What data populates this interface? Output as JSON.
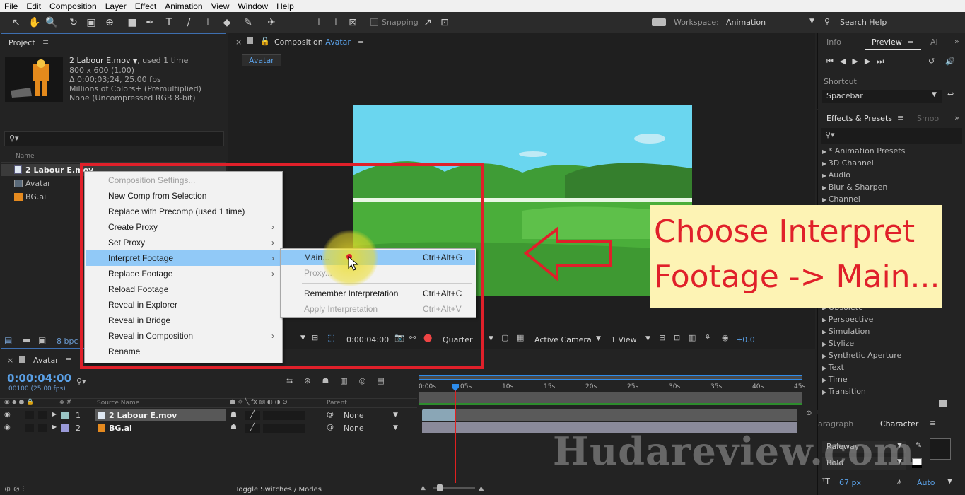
{
  "menubar": [
    "File",
    "Edit",
    "Composition",
    "Layer",
    "Effect",
    "Animation",
    "View",
    "Window",
    "Help"
  ],
  "toolbar": {
    "snapping": "Snapping",
    "workspace_label": "Workspace:",
    "workspace_value": "Animation",
    "search_help": "Search Help"
  },
  "project": {
    "title": "Project",
    "file_name": "2 Labour E.mov",
    "used": ", used 1 time",
    "dimensions": "800 x 600 (1.00)",
    "duration": "Δ 0;00;03;24, 25.00 fps",
    "colors": "Millions of Colors+ (Premultiplied)",
    "codec": "None (Uncompressed RGB 8-bit)",
    "name_col": "Name",
    "items": [
      "2 Labour E.mov",
      "Avatar",
      "BG.ai"
    ],
    "bpc": "8 bpc"
  },
  "composition": {
    "title": "Composition",
    "name": "Avatar",
    "tab": "Avatar",
    "timecode": "0:00:04:00",
    "quality": "Quarter",
    "camera": "Active Camera",
    "views": "1 View",
    "exposure": "+0.0"
  },
  "context_menu": {
    "items": [
      {
        "label": "Composition Settings...",
        "disabled": true,
        "submenu": false
      },
      {
        "label": "New Comp from Selection",
        "disabled": false,
        "submenu": false
      },
      {
        "label": "Replace with Precomp (used 1 time)",
        "disabled": false,
        "submenu": false
      },
      {
        "label": "Create Proxy",
        "disabled": false,
        "submenu": true
      },
      {
        "label": "Set Proxy",
        "disabled": false,
        "submenu": true
      },
      {
        "label": "Interpret Footage",
        "disabled": false,
        "submenu": true
      },
      {
        "label": "Replace Footage",
        "disabled": false,
        "submenu": true
      },
      {
        "label": "Reload Footage",
        "disabled": false,
        "submenu": false
      },
      {
        "label": "Reveal in Explorer",
        "disabled": false,
        "submenu": false
      },
      {
        "label": "Reveal in Bridge",
        "disabled": false,
        "submenu": false
      },
      {
        "label": "Reveal in Composition",
        "disabled": false,
        "submenu": true
      },
      {
        "label": "Rename",
        "disabled": false,
        "submenu": false
      }
    ]
  },
  "submenu": {
    "items": [
      {
        "label": "Main...",
        "shortcut": "Ctrl+Alt+G",
        "disabled": false
      },
      {
        "label": "Proxy...",
        "shortcut": "",
        "disabled": true
      },
      {
        "label": "Remember Interpretation",
        "shortcut": "Ctrl+Alt+C",
        "disabled": false
      },
      {
        "label": "Apply Interpretation",
        "shortcut": "Ctrl+Alt+V",
        "disabled": true
      }
    ]
  },
  "callout": {
    "line1": "Choose Interpret",
    "line2": "Footage -> Main..."
  },
  "right_panels": {
    "info_tab": "Info",
    "preview_tab": "Preview",
    "ai_tab": "Ai",
    "shortcut_label": "Shortcut",
    "shortcut_value": "Spacebar",
    "effects_tab": "Effects & Presets",
    "smoo_tab": "Smoo",
    "effects": [
      "* Animation Presets",
      "3D Channel",
      "Audio",
      "Blur & Sharpen",
      "Channel",
      "Obsolete",
      "Perspective",
      "Simulation",
      "Stylize",
      "Synthetic Aperture",
      "Text",
      "Time",
      "Transition"
    ],
    "paragraph_tab": "aragraph",
    "character_tab": "Character",
    "font": "Raleway",
    "style": "Bold",
    "size": "67 px",
    "leading": "Auto"
  },
  "timeline": {
    "tab": "Avatar",
    "timecode": "0:00:04:00",
    "frames": "00100 (25.00 fps)",
    "source_name_col": "Source Name",
    "parent_col": "Parent",
    "layers": [
      {
        "num": "1",
        "name": "2 Labour E.mov",
        "parent": "None"
      },
      {
        "num": "2",
        "name": "BG.ai",
        "parent": "None"
      }
    ],
    "ruler": [
      "0:00s",
      "05s",
      "10s",
      "15s",
      "20s",
      "25s",
      "30s",
      "35s",
      "40s",
      "45s"
    ],
    "toggle": "Toggle Switches / Modes"
  },
  "watermark": "Hudareview.com",
  "colors": {
    "accent_blue": "#2d8ceb",
    "callout_bg": "#fdf3b4",
    "callout_text": "#e0202a",
    "highlight_red": "#e0202a"
  }
}
